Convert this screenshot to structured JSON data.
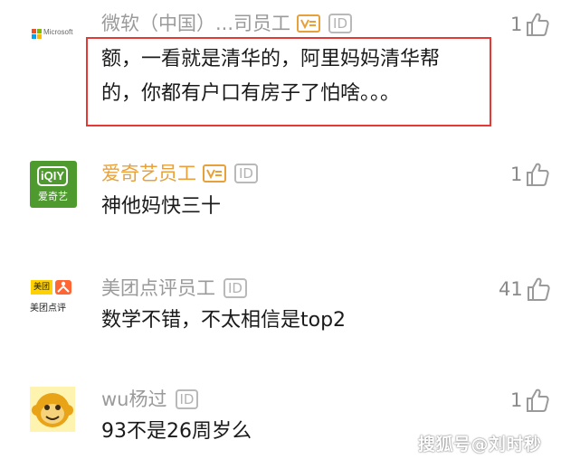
{
  "comments": [
    {
      "author": "微软（中国）...司员工",
      "avatar_label": "Microsoft",
      "badges": [
        "v-badge",
        "ID"
      ],
      "text_lines": [
        "额，一看就是清华的，阿里妈妈清华帮",
        "的，你都有户口有房子了怕啥。。。"
      ],
      "likes": "1",
      "highlighted": true
    },
    {
      "author": "爱奇艺员工",
      "avatar_label": "爱奇艺",
      "badges": [
        "v-badge",
        "ID"
      ],
      "text_lines": [
        "神他妈快三十"
      ],
      "likes": "1"
    },
    {
      "author": "美团点评员工",
      "avatar_label": "美团点评",
      "avatar_label_top": "美团",
      "badges": [
        "ID"
      ],
      "text_lines": [
        "数学不错，不太相信是top2"
      ],
      "likes": "41"
    },
    {
      "author": "wu杨过",
      "avatar_label": "",
      "badges": [
        "ID"
      ],
      "text_lines": [
        "93不是26周岁么"
      ],
      "likes": "1"
    }
  ],
  "badge_id_text": "ID",
  "watermark": "搜狐号@刘时秒",
  "colors": {
    "author_gray": "#9a9a9a",
    "author_orange": "#e8a13a",
    "highlight_border": "#e53935",
    "iqiyi_green": "#4f9a2e",
    "meituan_yellow": "#ffd100",
    "dianping_orange": "#ff6633"
  },
  "icons": {
    "like": "thumbs-up-icon",
    "verified": "v-badge-icon"
  }
}
